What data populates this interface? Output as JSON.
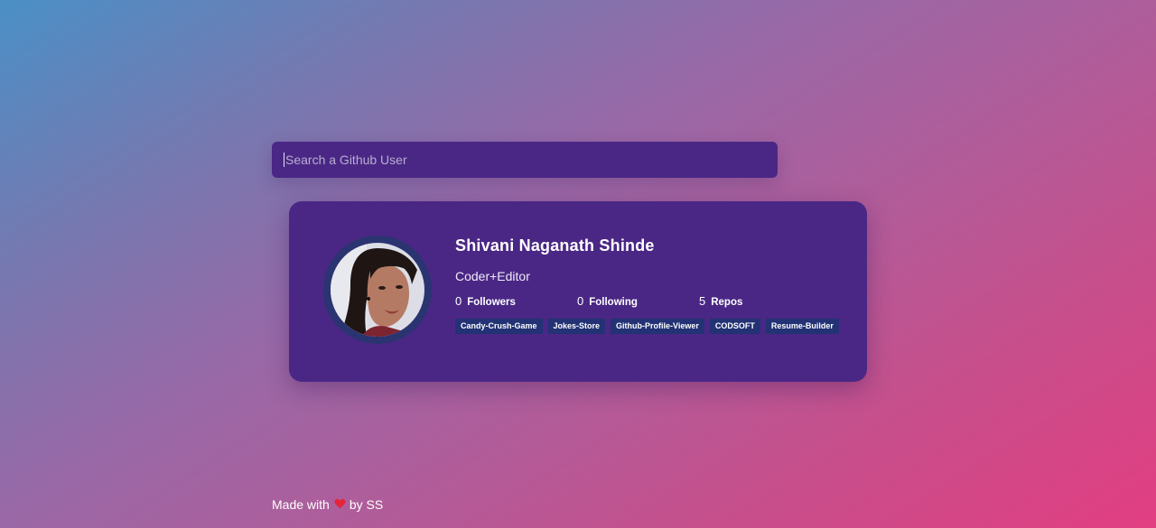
{
  "search": {
    "placeholder": "Search a Github User"
  },
  "profile": {
    "name": "Shivani Naganath Shinde",
    "bio": "Coder+Editor",
    "avatar_icon": "user-photo-avatar",
    "stats": [
      {
        "count": "0",
        "label": "Followers"
      },
      {
        "count": "0",
        "label": "Following"
      },
      {
        "count": "5",
        "label": "Repos"
      }
    ],
    "repos": [
      "Candy-Crush-Game",
      "Jokes-Store",
      "Github-Profile-Viewer",
      "CODSOFT",
      "Resume-Builder"
    ]
  },
  "footer": {
    "prefix": "Made with",
    "icon": "heart-icon",
    "suffix": "by SS"
  },
  "colors": {
    "card_bg": "#4a2785",
    "tag_bg": "#233274",
    "heart": "#e3263a",
    "gradient_start": "#4a90c6",
    "gradient_end": "#e23e82"
  }
}
